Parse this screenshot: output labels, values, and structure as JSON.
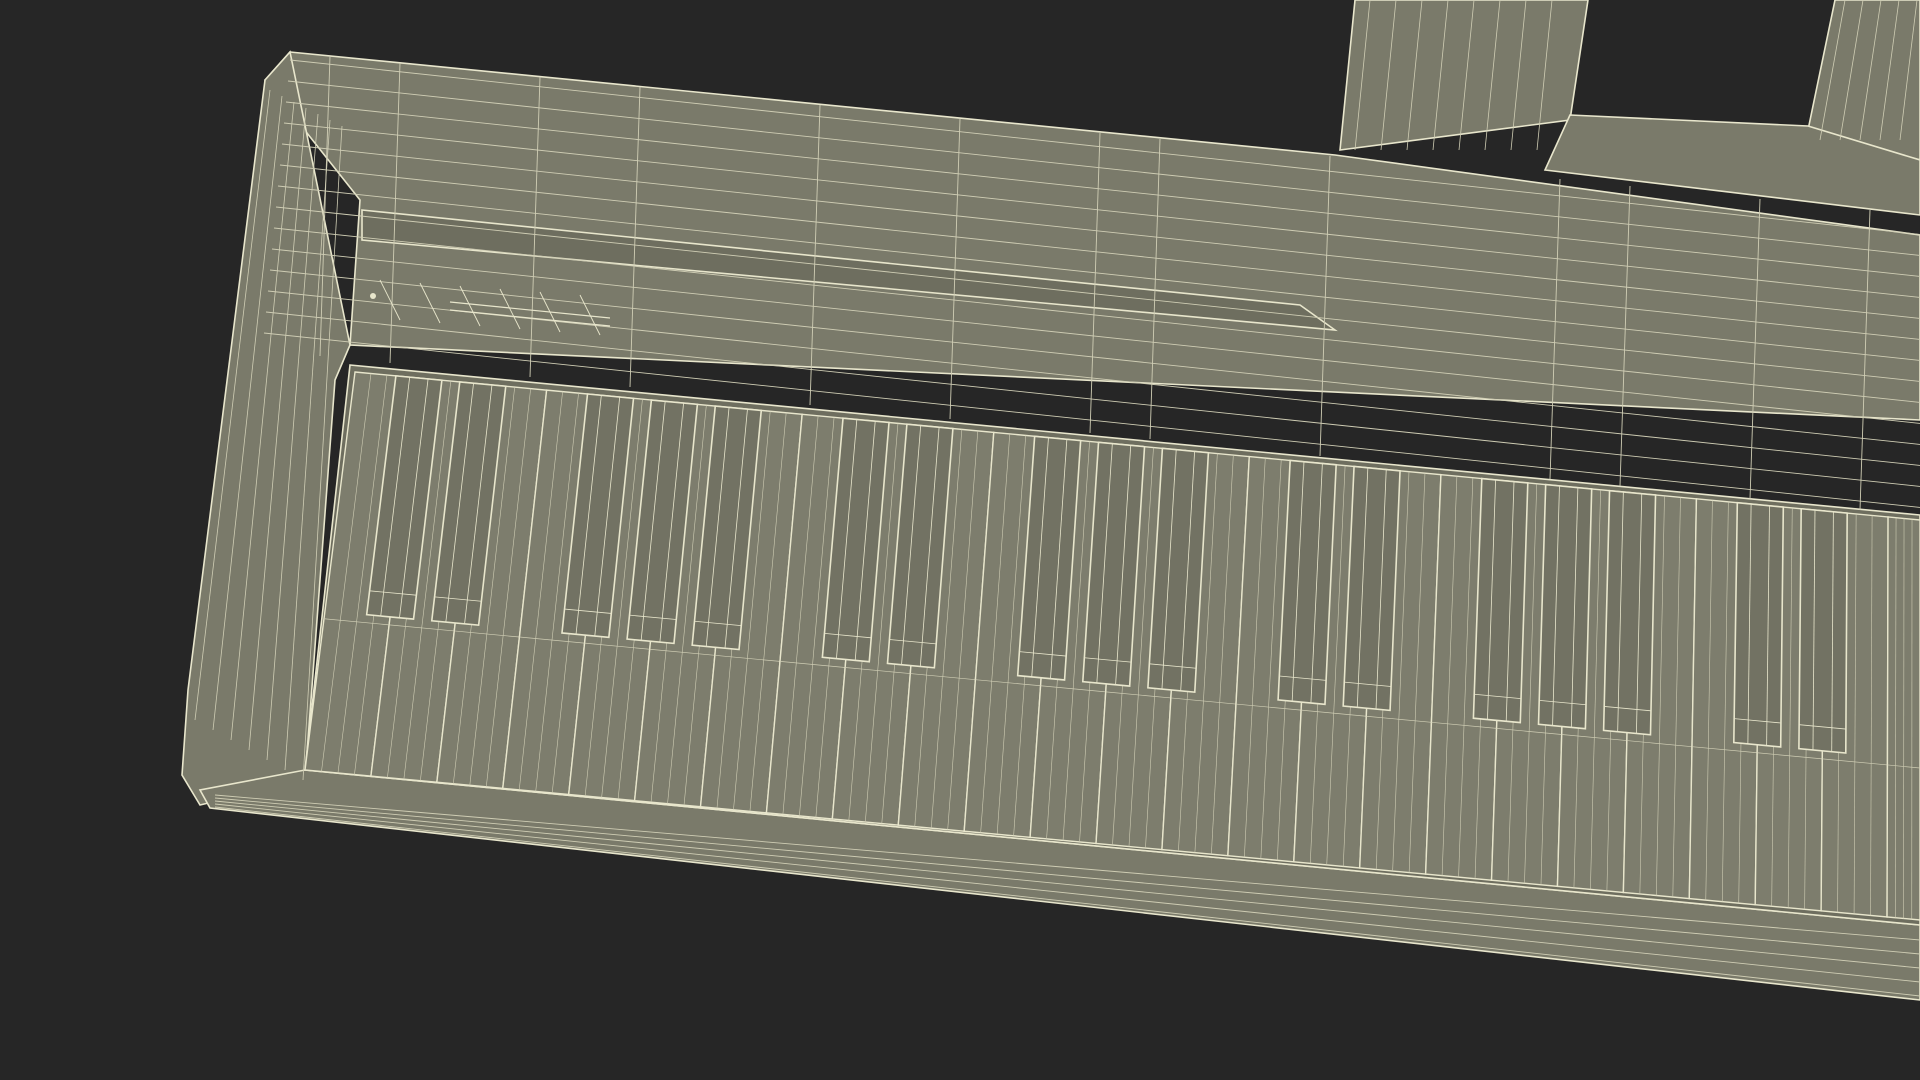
{
  "scene": {
    "subject": "keyboard-wireframe",
    "background_color": "#262626",
    "surface_color": "#7a7a6a",
    "surface_dark_color": "#6e6e5f",
    "key_color": "#7d7d6d",
    "black_key_color": "#727263",
    "wire_color": "#e8e6cc",
    "wire_faint_color": "#cfcdb4",
    "white_key_count": 25,
    "black_key_pattern": [
      1,
      1,
      0,
      1,
      1,
      1,
      0
    ]
  }
}
